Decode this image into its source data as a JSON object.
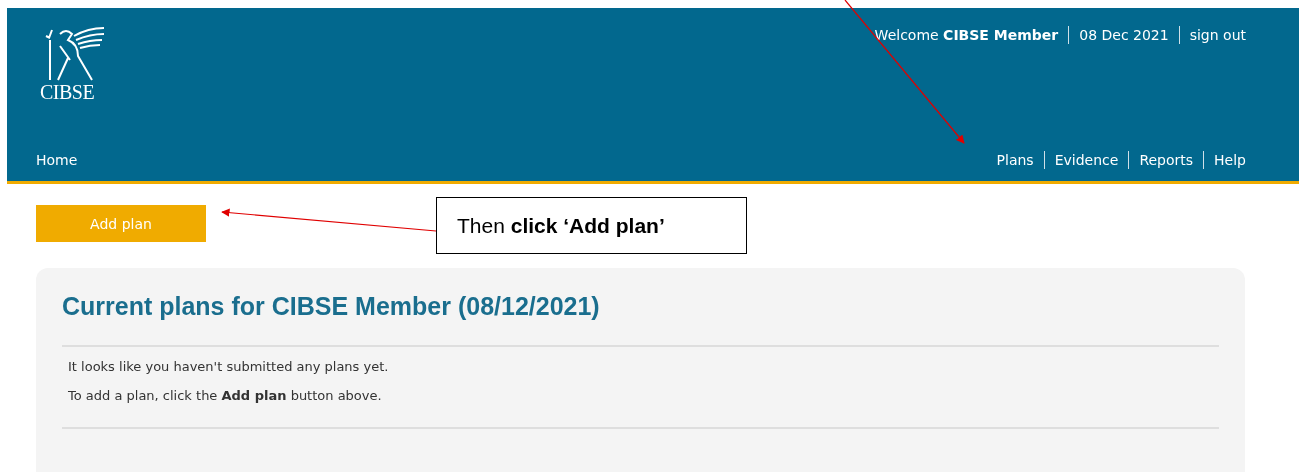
{
  "header": {
    "logo_text": "CIBSE",
    "welcome": "Welcome **CIBSE Member**",
    "date": "08 Dec 2021",
    "sign_out": "sign out",
    "home": "Home",
    "nav": [
      {
        "label": "Plans"
      },
      {
        "label": "Evidence"
      },
      {
        "label": "Reports"
      },
      {
        "label": "Help"
      }
    ]
  },
  "add_button": "Add plan",
  "callout": "Then **click ‘Add plan’**",
  "panel": {
    "title": "Current plans for CIBSE Member (08/12/2021)",
    "messages": [
      "It looks like you haven't submitted any plans yet.",
      "To add a plan, click the **Add plan** button above."
    ]
  }
}
